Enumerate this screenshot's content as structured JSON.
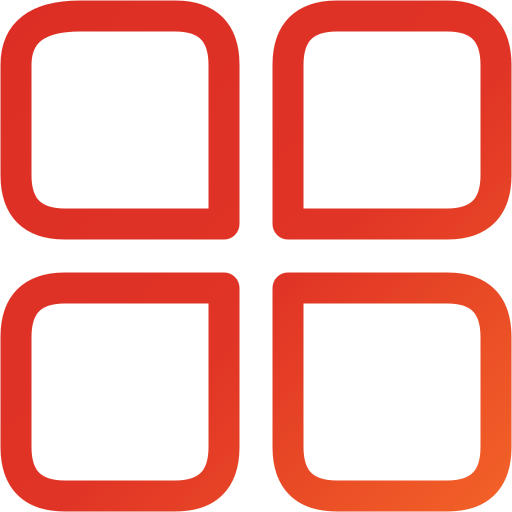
{
  "icon": {
    "name": "four-petal-grid-icon",
    "colors": {
      "gradient_start": "#dd2e25",
      "gradient_end": "#f36327",
      "background": "#ffffff"
    }
  }
}
